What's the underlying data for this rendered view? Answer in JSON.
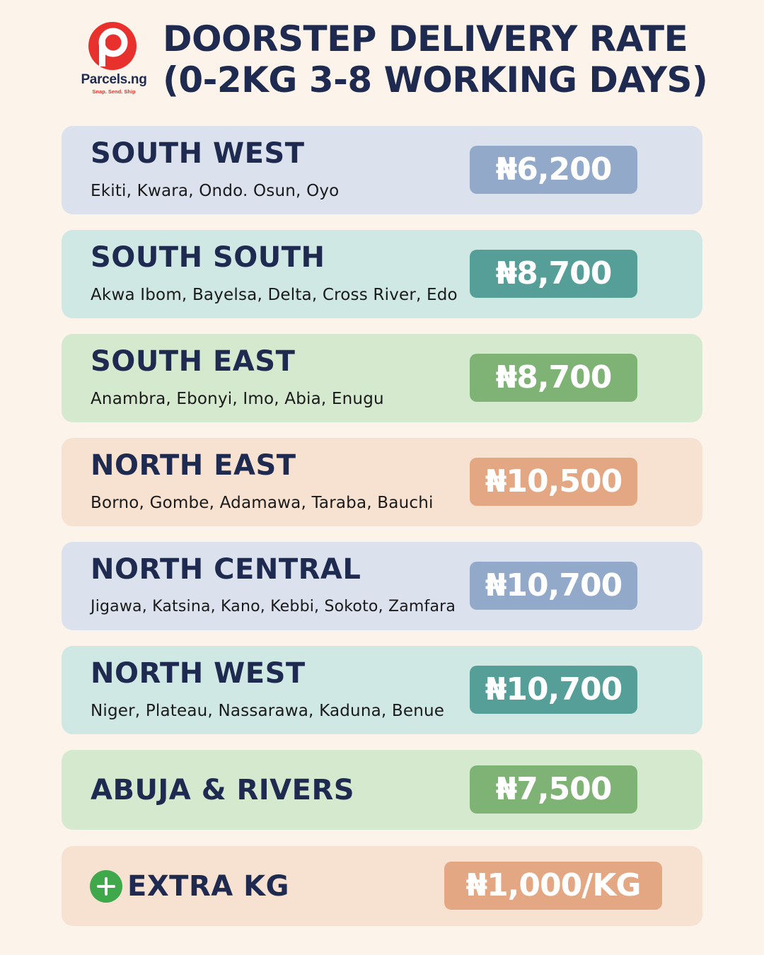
{
  "brand": {
    "name": "Parcels.ng",
    "tagline": "Snap. Send. Ship",
    "color": "#e8312c"
  },
  "title": {
    "line1": "DOORSTEP DELIVERY RATE",
    "line2": "(0-2KG 3-8 WORKING DAYS)"
  },
  "regions": [
    {
      "name": "SOUTH WEST",
      "states": "Ekiti, Kwara, Ondo. Osun, Oyo",
      "price": "₦6,200"
    },
    {
      "name": "SOUTH SOUTH",
      "states": "Akwa Ibom, Bayelsa, Delta, Cross River, Edo",
      "price": "₦8,700"
    },
    {
      "name": "SOUTH EAST",
      "states": "Anambra, Ebonyi, Imo, Abia, Enugu",
      "price": "₦8,700"
    },
    {
      "name": "NORTH EAST",
      "states": "Borno, Gombe, Adamawa, Taraba, Bauchi",
      "price": "₦10,500"
    },
    {
      "name": "NORTH CENTRAL",
      "states": "Jigawa, Katsina, Kano, Kebbi, Sokoto, Zamfara",
      "price": "₦10,700"
    },
    {
      "name": "NORTH WEST",
      "states": "Niger, Plateau, Nassarawa, Kaduna, Benue",
      "price": "₦10,700"
    },
    {
      "name": "ABUJA & RIVERS",
      "price": "₦7,500"
    }
  ],
  "extra": {
    "label": "EXTRA KG",
    "price": "₦1,000/KG",
    "icon": "plus-circle-icon"
  },
  "colors": {
    "background": "#fcf4ea",
    "text": "#1e2a4f",
    "blue_card": "#dbe1ed",
    "blue_price": "#92a9c9",
    "teal_card": "#cfe8e3",
    "teal_price": "#569e98",
    "green_card": "#d5e9cf",
    "green_price": "#7fb275",
    "peach_card": "#f7e1d0",
    "peach_price": "#e3a883"
  }
}
